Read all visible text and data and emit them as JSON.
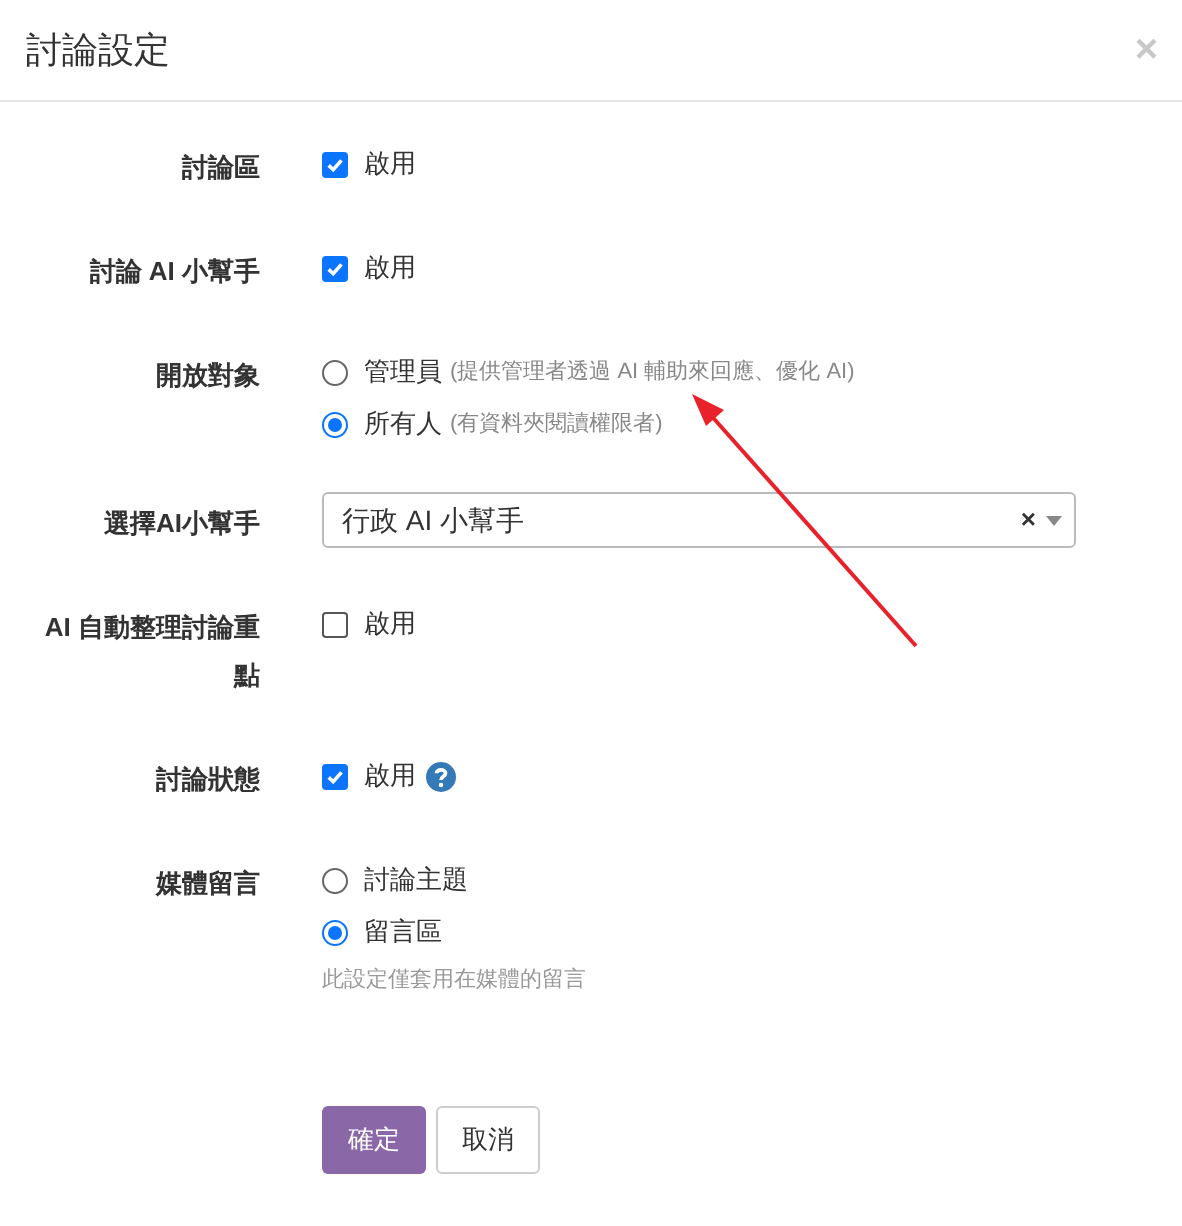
{
  "dialog": {
    "title": "討論設定",
    "close": "×"
  },
  "fields": [
    {
      "kind": "checkbox",
      "label": "討論區",
      "option": {
        "label": "啟用",
        "checked": true
      }
    },
    {
      "kind": "checkbox",
      "label": "討論 AI 小幫手",
      "option": {
        "label": "啟用",
        "checked": true
      }
    },
    {
      "kind": "radio",
      "label": "開放對象",
      "options": [
        {
          "label": "管理員",
          "note": "(提供管理者透過 AI 輔助來回應、優化 AI)",
          "selected": false
        },
        {
          "label": "所有人",
          "note": "(有資料夾閱讀權限者)",
          "selected": true
        }
      ]
    },
    {
      "kind": "select",
      "label": "選擇AI小幫手",
      "value": "行政 AI 小幫手",
      "clear": "×"
    },
    {
      "kind": "checkbox",
      "label": "AI 自動整理討論重點",
      "option": {
        "label": "啟用",
        "checked": false
      }
    },
    {
      "kind": "checkbox",
      "label": "討論狀態",
      "option": {
        "label": "啟用",
        "checked": true
      },
      "help": true
    },
    {
      "kind": "radio",
      "label": "媒體留言",
      "options": [
        {
          "label": "討論主題",
          "selected": false
        },
        {
          "label": "留言區",
          "selected": true
        }
      ],
      "hint": "此設定僅套用在媒體的留言"
    }
  ],
  "buttons": {
    "confirm": "確定",
    "cancel": "取消"
  }
}
